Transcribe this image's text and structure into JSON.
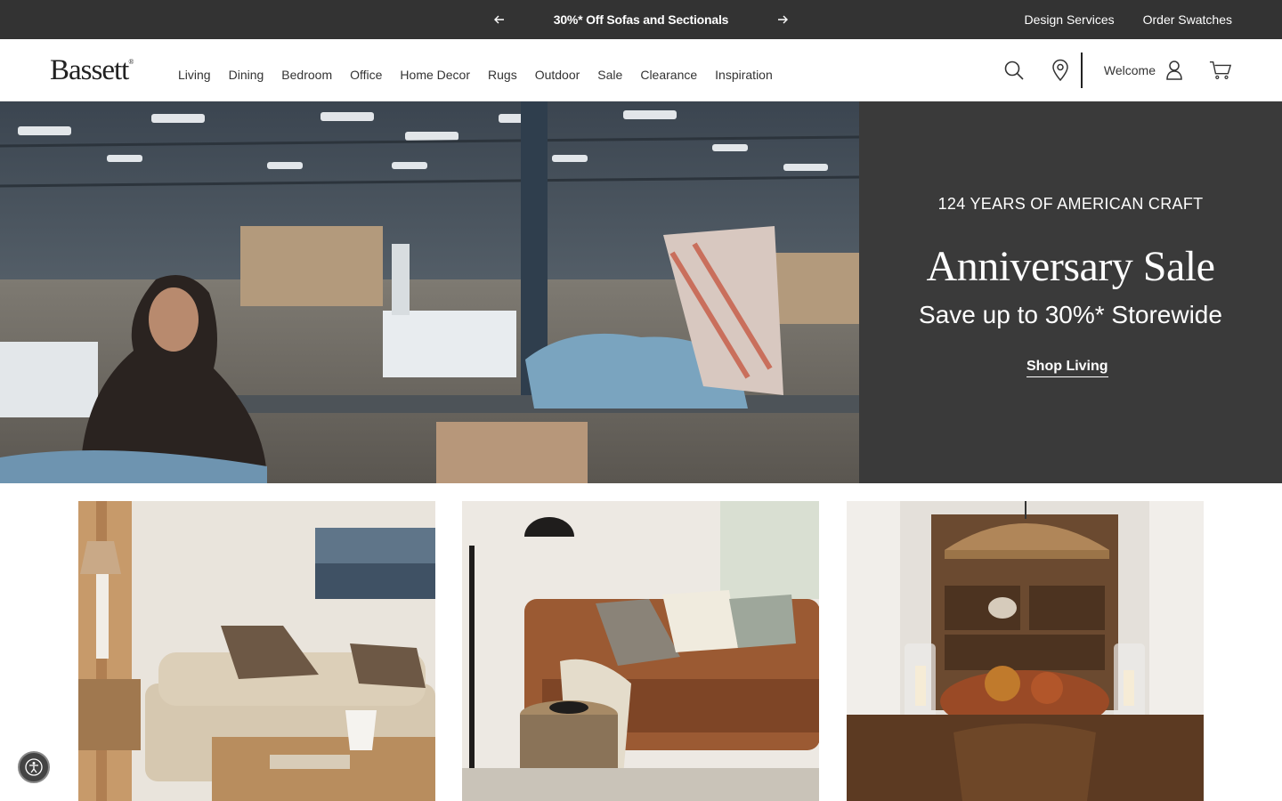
{
  "promo": {
    "message": "30%* Off Sofas and Sectionals",
    "links": [
      "Design Services",
      "Order Swatches"
    ]
  },
  "header": {
    "logo": "Bassett",
    "logo_mark": "®",
    "nav": [
      "Living",
      "Dining",
      "Bedroom",
      "Office",
      "Home Decor",
      "Rugs",
      "Outdoor",
      "Sale",
      "Clearance",
      "Inspiration"
    ],
    "welcome": "Welcome",
    "icons": [
      "search-icon",
      "location-pin-icon",
      "user-icon",
      "cart-icon"
    ]
  },
  "hero": {
    "eyebrow": "124 YEARS OF AMERICAN CRAFT",
    "title": "Anniversary Sale",
    "subtitle": "Save up to 30%* Storewide",
    "cta": "Shop Living",
    "panel_color": "#3a3a3a"
  },
  "tiles": [
    {
      "name": "living-room-sofa-tile"
    },
    {
      "name": "leather-sectional-tile"
    },
    {
      "name": "dining-room-tile"
    }
  ],
  "colors": {
    "promo_bar": "#333333",
    "text": "#222222"
  }
}
